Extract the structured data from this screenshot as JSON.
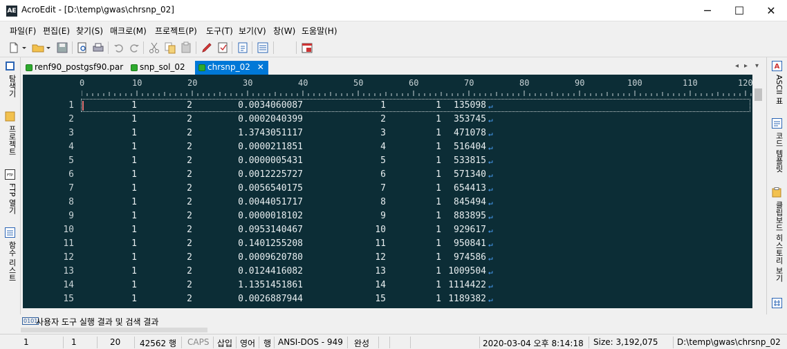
{
  "window": {
    "app_name": "AcroEdit",
    "title": "AcroEdit - [D:\\temp\\gwas\\chrsnp_02]",
    "minimize": "─",
    "maximize": "☐",
    "close": "✕",
    "icon_text": "AE"
  },
  "menu": [
    "파일(F)",
    "편집(E)",
    "찾기(S)",
    "매크로(M)",
    "프로젝트(P)",
    "도구(T)",
    "보기(V)",
    "창(W)",
    "도움말(H)"
  ],
  "tabs": [
    {
      "label": "renf90_postgsf90.par",
      "active": false
    },
    {
      "label": "snp_sol_02",
      "active": false
    },
    {
      "label": "chrsnp_02",
      "active": true
    }
  ],
  "tab_close": "✕",
  "tab_nav": {
    "prev": "◂",
    "next": "▸",
    "list": "▾"
  },
  "left_panel": [
    {
      "label": "탐색기",
      "icon": "explorer-icon"
    },
    {
      "label": "프로젝트",
      "icon": "project-icon"
    },
    {
      "label": "FTP 열기",
      "icon": "ftp-icon"
    },
    {
      "label": "함수 리스트",
      "icon": "function-list-icon"
    }
  ],
  "right_panel": [
    {
      "label": "ASCII 표",
      "icon": "ascii-table-icon"
    },
    {
      "label": "코드 템플릿",
      "icon": "code-template-icon"
    },
    {
      "label": "클립보드 히스토리 보기",
      "icon": "clipboard-icon"
    }
  ],
  "ruler": [
    "0",
    "10",
    "20",
    "30",
    "40",
    "50",
    "60",
    "70",
    "80",
    "90",
    "100",
    "110",
    "120"
  ],
  "rows": [
    {
      "n": "1",
      "c1": "1",
      "c2": "2",
      "c3": "0.0034060087",
      "c4": "1",
      "c5": "1",
      "c6": "135098"
    },
    {
      "n": "2",
      "c1": "1",
      "c2": "2",
      "c3": "0.0002040399",
      "c4": "2",
      "c5": "1",
      "c6": "353745"
    },
    {
      "n": "3",
      "c1": "1",
      "c2": "2",
      "c3": "1.3743051117",
      "c4": "3",
      "c5": "1",
      "c6": "471078"
    },
    {
      "n": "4",
      "c1": "1",
      "c2": "2",
      "c3": "0.0000211851",
      "c4": "4",
      "c5": "1",
      "c6": "516404"
    },
    {
      "n": "5",
      "c1": "1",
      "c2": "2",
      "c3": "0.0000005431",
      "c4": "5",
      "c5": "1",
      "c6": "533815"
    },
    {
      "n": "6",
      "c1": "1",
      "c2": "2",
      "c3": "0.0012225727",
      "c4": "6",
      "c5": "1",
      "c6": "571340"
    },
    {
      "n": "7",
      "c1": "1",
      "c2": "2",
      "c3": "0.0056540175",
      "c4": "7",
      "c5": "1",
      "c6": "654413"
    },
    {
      "n": "8",
      "c1": "1",
      "c2": "2",
      "c3": "0.0044051717",
      "c4": "8",
      "c5": "1",
      "c6": "845494"
    },
    {
      "n": "9",
      "c1": "1",
      "c2": "2",
      "c3": "0.0000018102",
      "c4": "9",
      "c5": "1",
      "c6": "883895"
    },
    {
      "n": "10",
      "c1": "1",
      "c2": "2",
      "c3": "0.0953140467",
      "c4": "10",
      "c5": "1",
      "c6": "929617"
    },
    {
      "n": "11",
      "c1": "1",
      "c2": "2",
      "c3": "0.1401255208",
      "c4": "11",
      "c5": "1",
      "c6": "950841"
    },
    {
      "n": "12",
      "c1": "1",
      "c2": "2",
      "c3": "0.0009620780",
      "c4": "12",
      "c5": "1",
      "c6": "974586"
    },
    {
      "n": "13",
      "c1": "1",
      "c2": "2",
      "c3": "0.0124416082",
      "c4": "13",
      "c5": "1",
      "c6": "1009504"
    },
    {
      "n": "14",
      "c1": "1",
      "c2": "2",
      "c3": "1.1351451861",
      "c4": "14",
      "c5": "1",
      "c6": "1114422"
    },
    {
      "n": "15",
      "c1": "1",
      "c2": "2",
      "c3": "0.0026887944",
      "c4": "15",
      "c5": "1",
      "c6": "1189382"
    }
  ],
  "eol_mark": "↵",
  "output_panel": {
    "label": "사용자 도구 실행 결과 및 검색 결과",
    "icon_text": "0101"
  },
  "status": {
    "line": "1",
    "col": "1",
    "val3": "20",
    "lines": "42562 행",
    "caps": "CAPS",
    "insert": "삽입",
    "lang": "영어",
    "row_mode": "행",
    "encoding": "ANSI-DOS - 949",
    "state": "완성",
    "datetime": "2020-03-04 오후 8:14:18",
    "size": "Size: 3,192,075",
    "path": "D:\\temp\\gwas\\chrsnp_02"
  },
  "colors": {
    "editor_bg": "#0c2d36",
    "editor_text": "#e8eef0",
    "active_tab": "#0078d7",
    "eol": "#4da3ff"
  }
}
